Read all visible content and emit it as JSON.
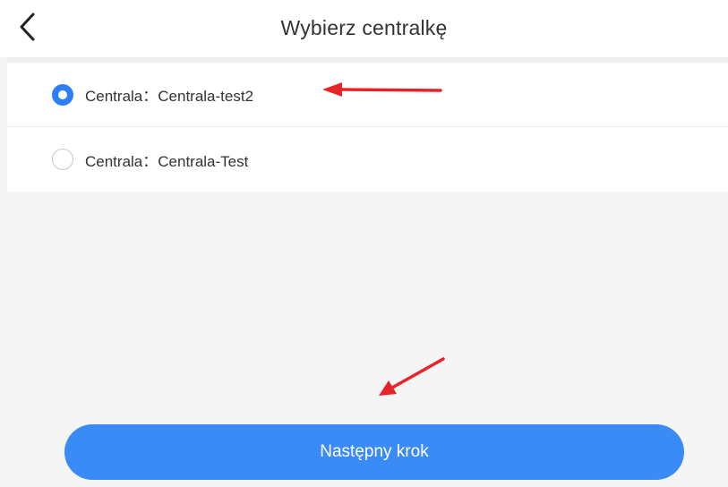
{
  "header": {
    "title": "Wybierz centralkę",
    "back_icon": "chevron-left-icon"
  },
  "options": [
    {
      "label": "Centrala：Centrala-test2",
      "selected": true
    },
    {
      "label": "Centrala：Centrala-Test",
      "selected": false
    }
  ],
  "footer": {
    "next_label": "Następny krok"
  },
  "colors": {
    "accent": "#3b8bf6",
    "radio_selected": "#2c7ff5",
    "annotation_arrow": "#e8232a",
    "background": "#f5f5f5"
  }
}
